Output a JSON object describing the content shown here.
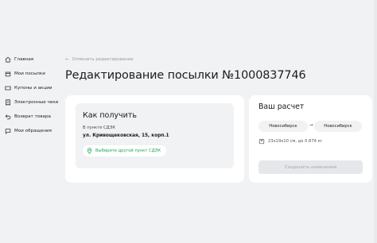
{
  "sidebar": {
    "items": [
      {
        "label": "Главная",
        "icon": "home-icon"
      },
      {
        "label": "Мои посылки",
        "icon": "parcels-icon"
      },
      {
        "label": "Купоны и акции",
        "icon": "coupon-icon"
      },
      {
        "label": "Электронные чеки",
        "icon": "receipt-icon"
      },
      {
        "label": "Возврат товара",
        "icon": "return-icon"
      },
      {
        "label": "Мои обращения",
        "icon": "chat-icon"
      }
    ]
  },
  "breadcrumb": {
    "arrow": "←",
    "label": "Отменить редактирование"
  },
  "page": {
    "title": "Редактирование посылки №1000837746"
  },
  "delivery": {
    "heading": "Как получить",
    "method": "В пункте СДЭК",
    "address": "ул. Кривощековская, 15, корп.1",
    "change_button": "Выберите другой пункт СДЭК",
    "change_icon": "location-pin-icon"
  },
  "calc": {
    "heading": "Ваш расчет",
    "from_city": "Новосибирск",
    "route_arrow": "→",
    "to_city": "Новосибирск",
    "parcel_info": "23x19x10 см, до 0.874 кг",
    "parcel_icon": "box-icon",
    "save_button": "Сохранить изменения"
  },
  "colors": {
    "accent_green": "#1aa84f",
    "background": "#f1f2f4",
    "disabled_button": "#e6e7ea"
  }
}
